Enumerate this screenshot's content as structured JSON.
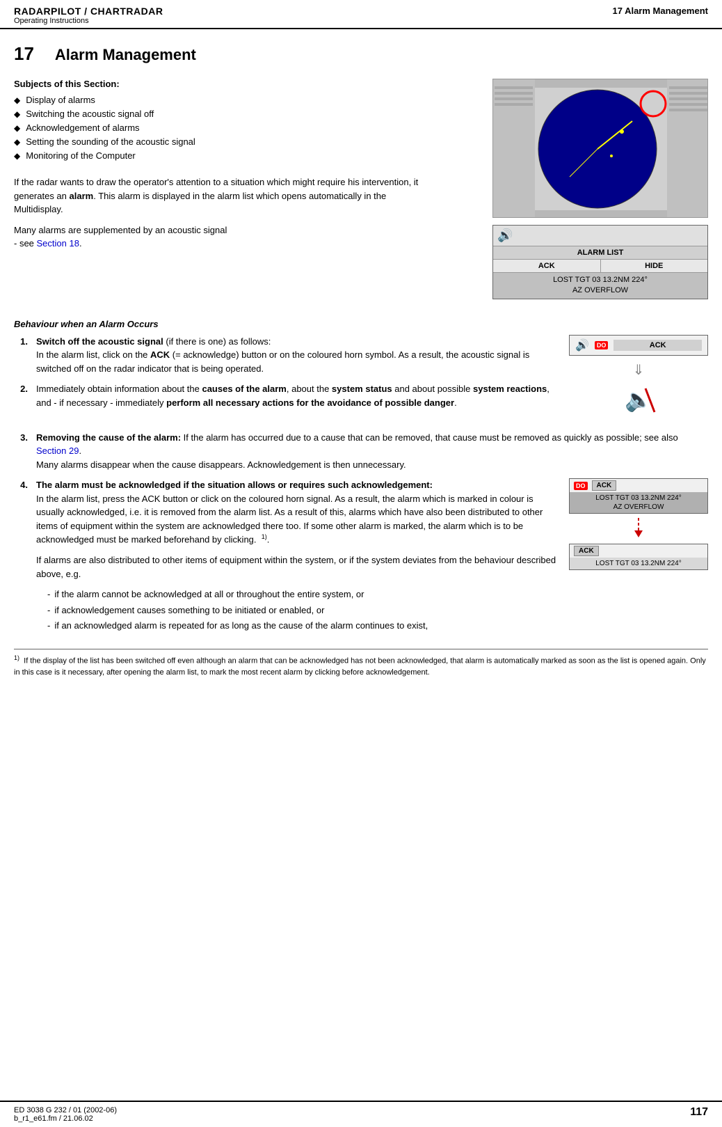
{
  "header": {
    "title_main": "RADARPILOT / CHARTRADAR",
    "subtitle": "Operating Instructions",
    "chapter_ref": "17  Alarm Management"
  },
  "chapter": {
    "number": "17",
    "title": "Alarm Management"
  },
  "subjects": {
    "heading": "Subjects of this Section:",
    "items": [
      "Display of alarms",
      "Switching the acoustic signal off",
      "Acknowledgement of alarms",
      "Setting the sounding of the acoustic signal",
      "Monitoring of the Computer"
    ]
  },
  "intro_paragraphs": [
    "If the radar wants to draw the operator's attention to a situation which might require his intervention, it generates an alarm. This alarm is displayed in the alarm list which opens automatically in the Multidisplay.",
    "Many alarms are supplemented by an acoustic signal - see Section 18."
  ],
  "alarm_list_widget": {
    "title": "ALARM LIST",
    "ack_btn": "ACK",
    "hide_btn": "HIDE",
    "entry_line1": "LOST TGT 03 13.2NM 224°",
    "entry_line2": "AZ OVERFLOW"
  },
  "behaviour_section": {
    "heading": "Behaviour when an Alarm Occurs",
    "items": [
      {
        "number": "1.",
        "bold_prefix": "Switch off the acoustic signal",
        "text": " (if there is one) as follows:\nIn the alarm list, click on the ACK (= acknowledge) button or on the coloured horn symbol. As a result, the acoustic signal is switched off on the radar indicator that is being operated."
      },
      {
        "number": "2.",
        "text": "Immediately obtain information about the causes of the alarm, about the system status and about possible system reactions, and - if necessary - immediately perform all necessary actions for the avoidance of possible danger."
      },
      {
        "number": "3.",
        "bold_prefix": "Removing the cause of the alarm:",
        "text": " If the alarm has occurred due to a cause that can be removed, that cause must be removed as quickly as possible; see also Section 29.\nMany alarms disappear when the cause disappears. Acknowledgement is then unnecessary."
      },
      {
        "number": "4.",
        "bold_prefix": "The alarm must be acknowledged if the situation allows or requires such acknowledgement:",
        "text": "\nIn the alarm list, press the ACK button or click on the coloured horn signal. As a result, the alarm which is marked in colour is usually acknowledged, i.e. it is removed from the alarm list. As a result of this, alarms which have also been distributed to other items of equipment within the system are acknowledged there too. If some other alarm is marked, the alarm which is to be acknowledged must be marked beforehand by clicking."
      }
    ]
  },
  "ack_widget": {
    "ack_label": "ACK",
    "do_badge": "DO"
  },
  "alarm_panels": {
    "panel1": {
      "do_badge": "DO",
      "ack_label": "ACK",
      "entry_line1": "LOST TGT 03 13.2NM 224°",
      "entry_line2": "AZ OVERFLOW"
    },
    "panel2": {
      "ack_label": "ACK",
      "entry_line1": "LOST TGT 03 13.2NM 224°"
    }
  },
  "additional_text_1": "1). ",
  "if_alarms_para": "If alarms are also distributed to other items of equipment within the system, or if the system deviates from the behaviour described above, e.g.",
  "dash_items": [
    "if the alarm cannot be acknowledged at all or throughout the entire system, or",
    "if acknowledgement causes something to be initiated or enabled, or",
    "if an acknowledged alarm is repeated for as long as the cause of the alarm continues to exist,"
  ],
  "footnote": {
    "number": "1)",
    "text": "If the display of the list has been switched off even although an alarm that can be acknowledged has not been acknowledged, that alarm is automatically marked as soon as the list is opened again. Only in this case is it necessary, after opening the alarm list, to mark the most recent alarm by clicking before acknowledgement."
  },
  "footer": {
    "left_line1": "ED 3038 G 232 / 01 (2002-06)",
    "left_line2": "b_r1_e61.fm / 21.06.02",
    "page_number": "117"
  }
}
